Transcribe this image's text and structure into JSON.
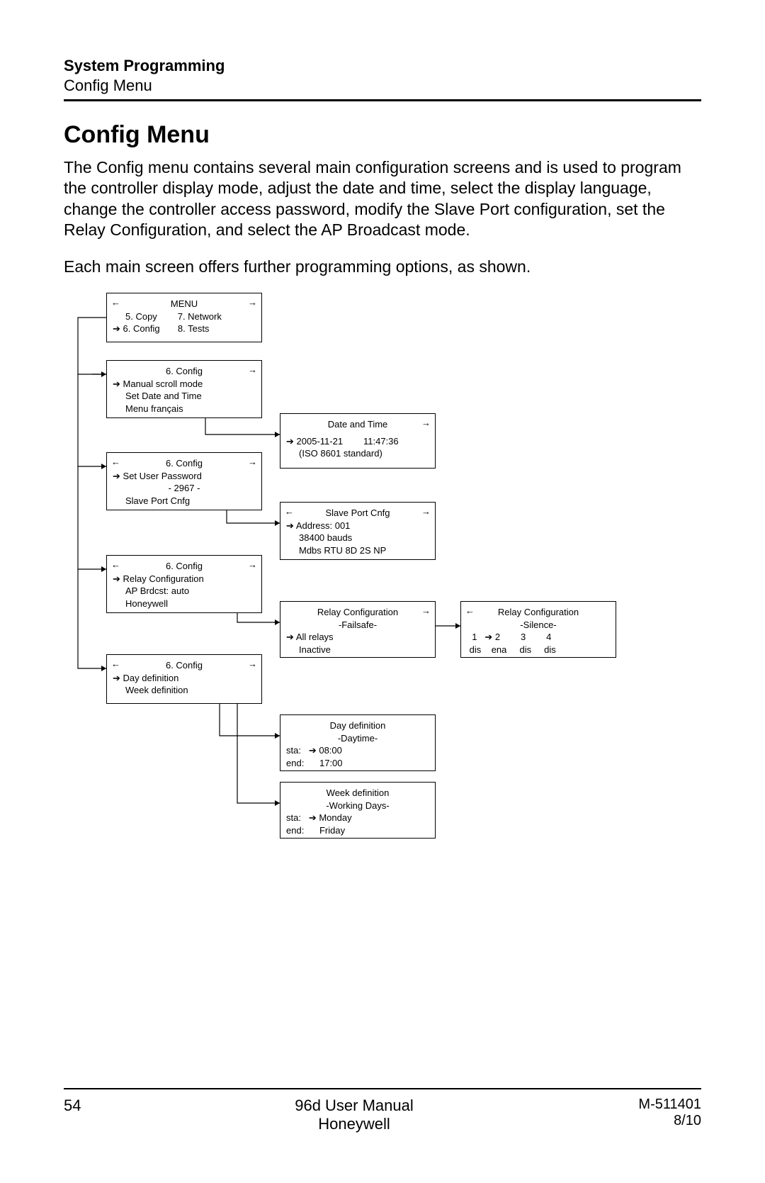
{
  "header": {
    "section": "System Programming",
    "subsection": "Config Menu"
  },
  "title": "Config Menu",
  "para1": "The Config menu contains several main configuration screens and is used to program the controller display mode, adjust the date and time, select the display language, change the controller access password, modify the Slave Port configuration, set the Relay Configuration, and select the AP Broadcast mode.",
  "para2": "Each main screen offers further programming options, as shown.",
  "screens": {
    "menu": {
      "title": "MENU",
      "l1a": "5. Copy",
      "l1b": "7. Network",
      "l2a": "6. Config",
      "l2b": "8. Tests"
    },
    "cfg1": {
      "title": "6. Config",
      "l1": "Manual scroll mode",
      "l2": "Set Date and Time",
      "l3": "Menu français"
    },
    "date": {
      "title": "Date and Time",
      "l1a": "2005-11-21",
      "l1b": "11:47:36",
      "l2": "(ISO 8601 standard)"
    },
    "cfg2": {
      "title": "6. Config",
      "l1": "Set User Password",
      "l2": "- 2967 -",
      "l3": "Slave Port Cnfg"
    },
    "slave": {
      "title": "Slave Port Cnfg",
      "l1": "Address: 001",
      "l2": "38400 bauds",
      "l3": "Mdbs RTU 8D 2S NP"
    },
    "cfg3": {
      "title": "6. Config",
      "l1": "Relay Configuration",
      "l2": "AP Brdcst: auto",
      "l3": "Honeywell"
    },
    "relayF": {
      "title": "Relay Configuration",
      "sub": "-Failsafe-",
      "l1": "All relays",
      "l2": "Inactive"
    },
    "relayS": {
      "title": "Relay Configuration",
      "sub": "-Silence-",
      "h1": "1",
      "h2": "2",
      "h3": "3",
      "h4": "4",
      "v1": "dis",
      "v2": "ena",
      "v3": "dis",
      "v4": "dis"
    },
    "cfg4": {
      "title": "6. Config",
      "l1": "Day definition",
      "l2": "Week definition"
    },
    "day": {
      "title": "Day definition",
      "sub": "-Daytime-",
      "l1a": "sta:",
      "l1b": "08:00",
      "l2a": "end:",
      "l2b": "17:00"
    },
    "week": {
      "title": "Week  definition",
      "sub": "-Working Days-",
      "l1a": "sta:",
      "l1b": "Monday",
      "l2a": "end:",
      "l2b": "Friday"
    }
  },
  "footer": {
    "page": "54",
    "center1": "96d User Manual",
    "center2": "Honeywell",
    "right1": "M-511401",
    "right2": "8/10"
  }
}
